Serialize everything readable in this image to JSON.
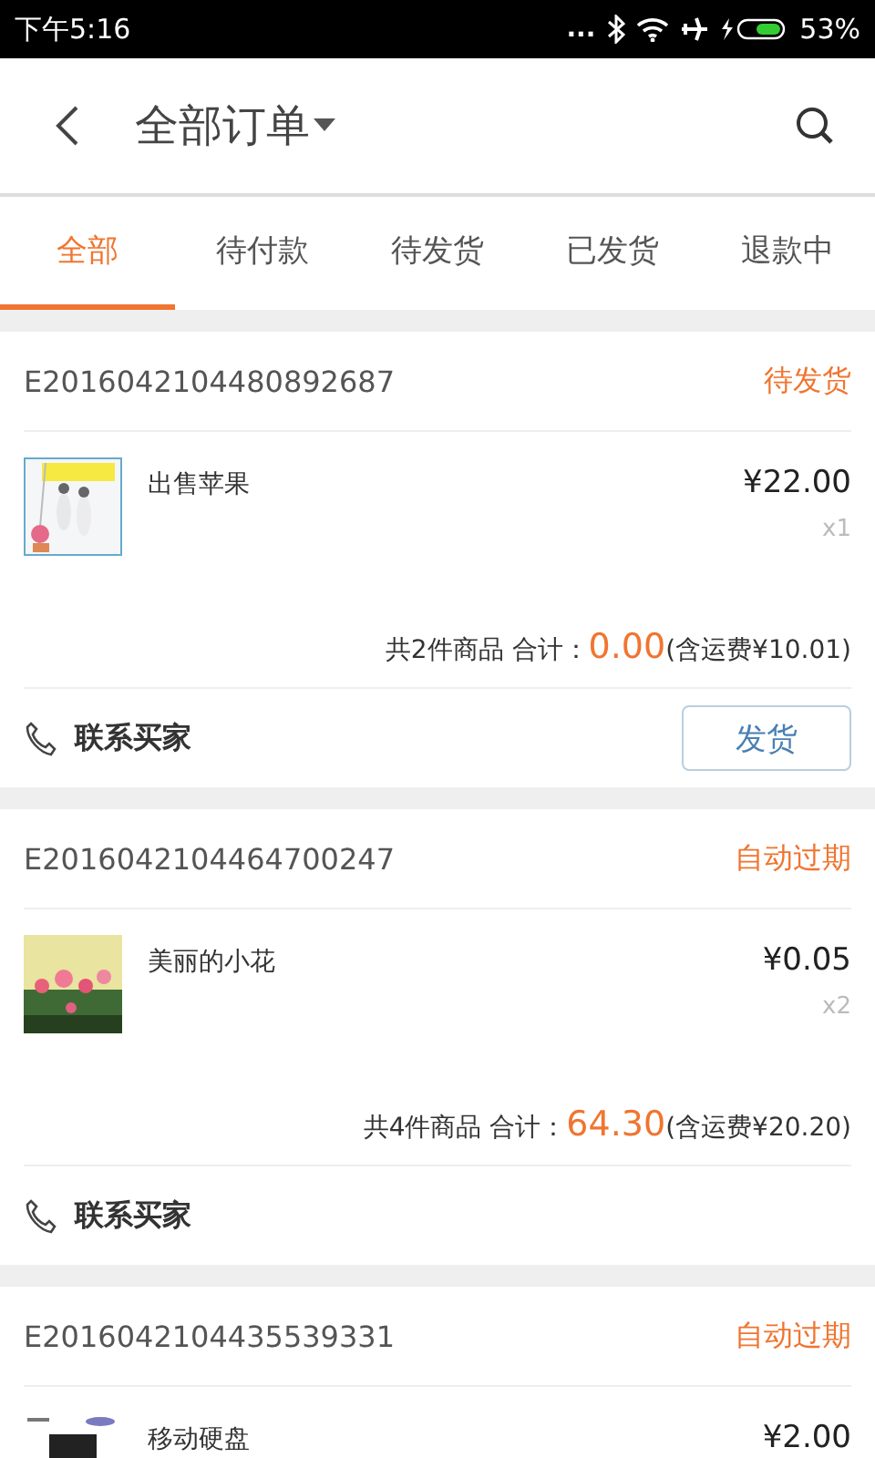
{
  "status_bar": {
    "time": "下午5:16",
    "dots": "...",
    "battery_text": "53%"
  },
  "header": {
    "title": "全部订单"
  },
  "tabs": [
    {
      "label": "全部",
      "selected": true
    },
    {
      "label": "待付款",
      "selected": false
    },
    {
      "label": "待发货",
      "selected": false
    },
    {
      "label": "已发货",
      "selected": false
    },
    {
      "label": "退款中",
      "selected": false
    }
  ],
  "orders": [
    {
      "order_no": "E2016042104480892687",
      "status": "待发货",
      "products": [
        {
          "name": "出售苹果",
          "price": "¥22.00",
          "qty": "x1"
        }
      ],
      "summary": {
        "count": "共2件商品 合计：",
        "amount": "0.00",
        "freight": "(含运费¥10.01)"
      },
      "contact": "联系买家",
      "action": "发货"
    },
    {
      "order_no": "E2016042104464700247",
      "status": "自动过期",
      "products": [
        {
          "name": "美丽的小花",
          "price": "¥0.05",
          "qty": "x2"
        }
      ],
      "summary": {
        "count": "共4件商品 合计：",
        "amount": "64.30",
        "freight": "(含运费¥20.20)"
      },
      "contact": "联系买家"
    },
    {
      "order_no": "E2016042104435539331",
      "status": "自动过期",
      "products": [
        {
          "name": "移动硬盘",
          "price": "¥2.00"
        }
      ]
    }
  ]
}
